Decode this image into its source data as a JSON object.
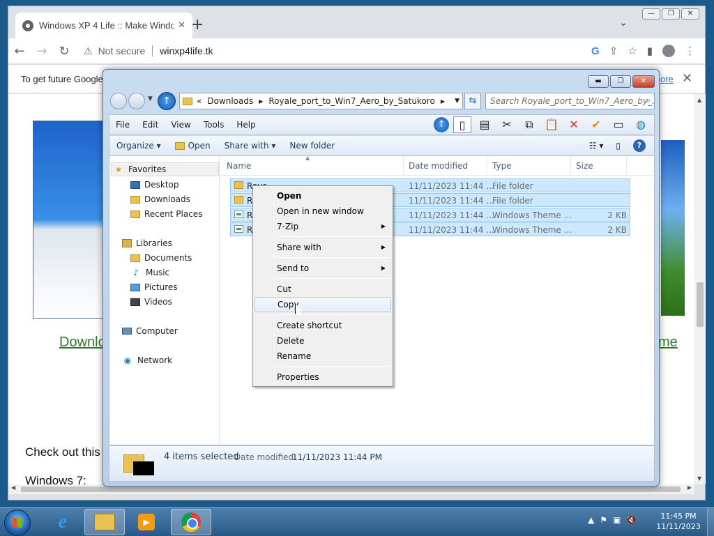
{
  "browser": {
    "tab_title": "Windows XP 4 Life :: Make Windo",
    "security_label": "Not secure",
    "url": "winxp4life.tk",
    "infobar_message": "To get future Google",
    "infobar_link": "ore"
  },
  "webpage": {
    "link_left": "Downlo",
    "link_right": "me",
    "checkout_text": "Check out this",
    "windows7_text": "Windows 7:"
  },
  "explorer": {
    "address_prefix": "«",
    "breadcrumbs": [
      "Downloads",
      "Royale_port_to_Win7_Aero_by_Satukoro"
    ],
    "search_placeholder": "Search Royale_port_to_Win7_Aero_by_...",
    "menu": [
      "File",
      "Edit",
      "View",
      "Tools",
      "Help"
    ],
    "commands": {
      "organize": "Organize",
      "open": "Open",
      "share_with": "Share with",
      "new_folder": "New folder"
    },
    "nav": {
      "favorites": "Favorites",
      "desktop": "Desktop",
      "downloads": "Downloads",
      "recent_places": "Recent Places",
      "libraries": "Libraries",
      "documents": "Documents",
      "music": "Music",
      "pictures": "Pictures",
      "videos": "Videos",
      "computer": "Computer",
      "network": "Network"
    },
    "columns": {
      "name": "Name",
      "date_modified": "Date modified",
      "type": "Type",
      "size": "Size"
    },
    "files": [
      {
        "name": "Royale",
        "date": "11/11/2023 11:44 ...",
        "type": "File folder",
        "size": "",
        "icon": "folder-icon"
      },
      {
        "name": "Ro",
        "date": "11/11/2023 11:44 ...",
        "type": "File folder",
        "size": "",
        "icon": "folder-icon"
      },
      {
        "name": "Ro",
        "date": "11/11/2023 11:44 ...",
        "type": "Windows Theme ...",
        "size": "2 KB",
        "icon": "theme-file-icon"
      },
      {
        "name": "Ro",
        "date": "11/11/2023 11:44 ...",
        "type": "Windows Theme ...",
        "size": "2 KB",
        "icon": "theme-file-icon"
      }
    ],
    "details": {
      "count": "4 items selected",
      "date_label": "Date modified:",
      "date_value": "11/11/2023 11:44 PM"
    }
  },
  "context_menu": {
    "open": "Open",
    "open_new_window": "Open in new window",
    "seven_zip": "7-Zip",
    "share_with": "Share with",
    "send_to": "Send to",
    "cut": "Cut",
    "copy": "Copy",
    "create_shortcut": "Create shortcut",
    "delete": "Delete",
    "rename": "Rename",
    "properties": "Properties"
  },
  "taskbar": {
    "time": "11:45 PM",
    "date": "11/11/2023"
  },
  "colors": {
    "selection": "#cce8ff",
    "selection_border": "#99c9ef",
    "link_green": "#2a7a2a",
    "taskbar": "#2a5a88"
  }
}
